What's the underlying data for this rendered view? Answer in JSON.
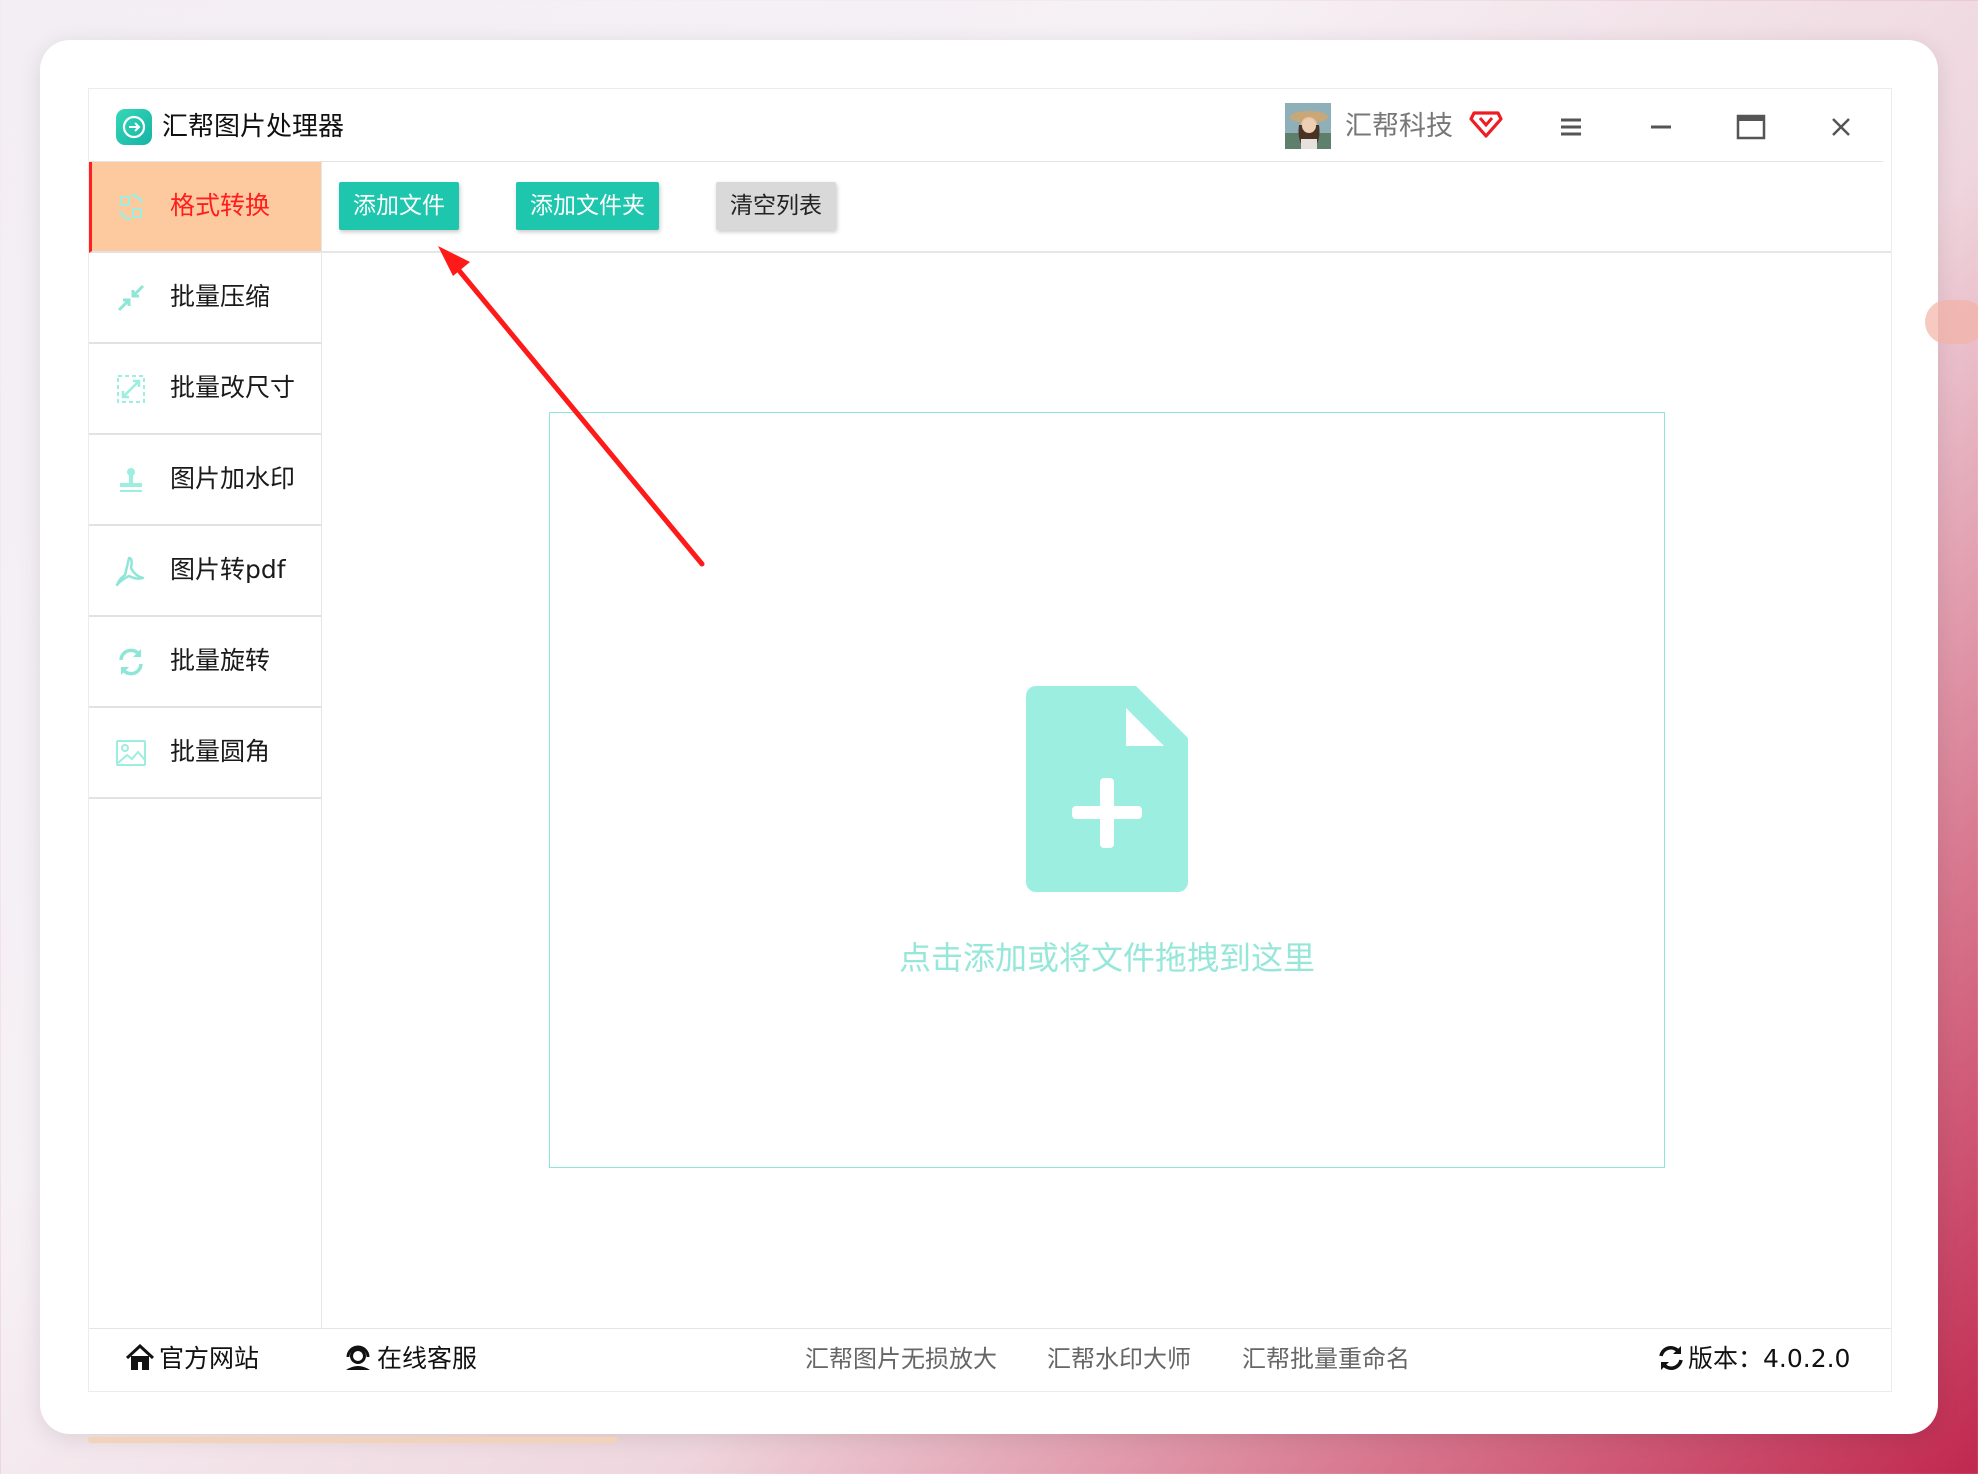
{
  "window": {
    "app_title": "汇帮图片处理器",
    "username": "汇帮科技",
    "logo_icon": "app-logo-icon",
    "vip_icon": "vip-diamond-icon"
  },
  "sidebar": {
    "items": [
      {
        "label": "格式转换",
        "icon": "format-convert-icon",
        "active": true
      },
      {
        "label": "批量压缩",
        "icon": "compress-arrows-icon"
      },
      {
        "label": "批量改尺寸",
        "icon": "resize-icon"
      },
      {
        "label": "图片加水印",
        "icon": "stamp-icon"
      },
      {
        "label": "图片转pdf",
        "icon": "pdf-icon"
      },
      {
        "label": "批量旋转",
        "icon": "rotate-icon"
      },
      {
        "label": "批量圆角",
        "icon": "image-corner-icon"
      }
    ]
  },
  "toolbar": {
    "add_file": "添加文件",
    "add_folder": "添加文件夹",
    "clear_list": "清空列表"
  },
  "dropzone": {
    "hint": "点击添加或将文件拖拽到这里",
    "icon": "add-file-icon"
  },
  "statusbar": {
    "official_site": "官方网站",
    "online_service": "在线客服",
    "links": [
      "汇帮图片无损放大",
      "汇帮水印大师",
      "汇帮批量重命名"
    ],
    "version": "版本：4.0.2.0"
  },
  "colors": {
    "accent_green": "#1ec6ad",
    "active_bg": "#fdcaa0",
    "active_text": "#ff1d1d",
    "icon_teal": "#9beee0",
    "annotation_arrow": "#ff1a1a"
  }
}
